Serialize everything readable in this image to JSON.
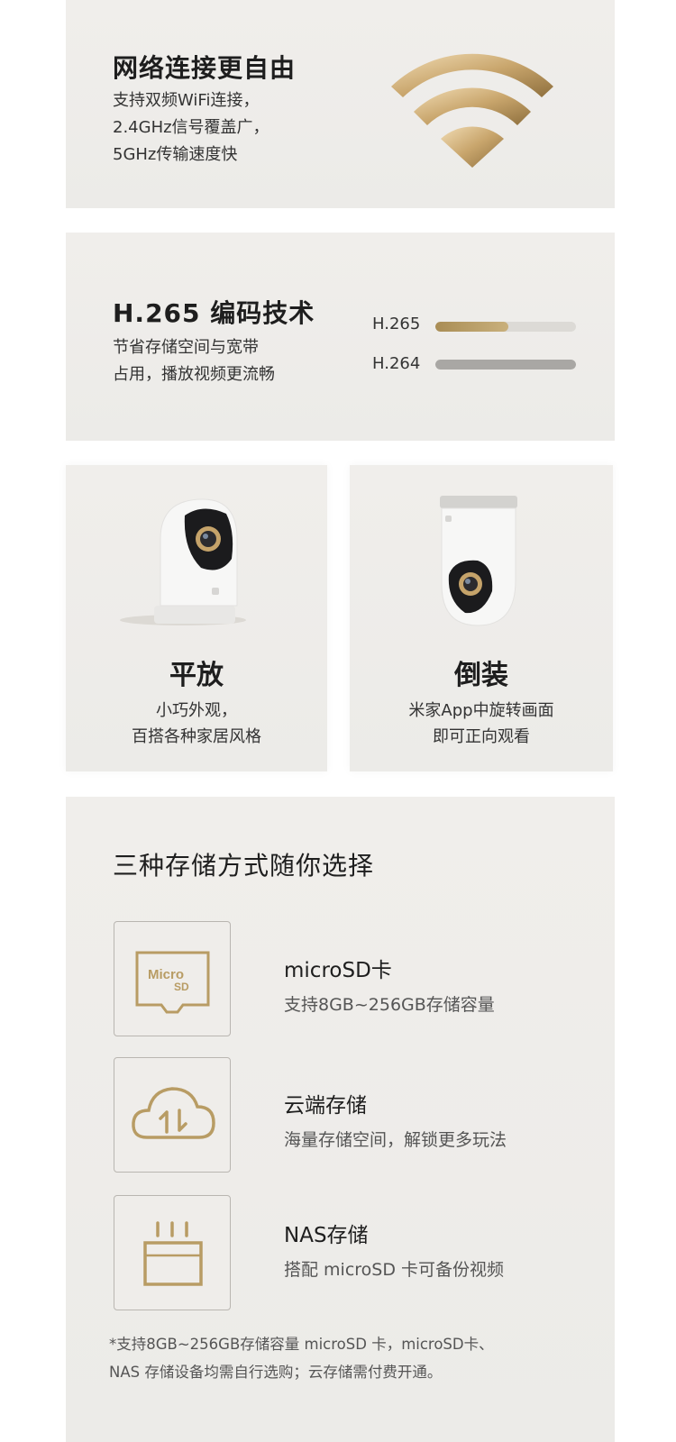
{
  "wifi": {
    "title": "网络连接更自由",
    "desc_lines": [
      "支持双频WiFi连接，",
      "2.4GHz信号覆盖广，",
      "5GHz传输速度快"
    ],
    "icon": "wifi-icon"
  },
  "codec": {
    "title": "H.265 编码技术",
    "desc_lines": [
      "节省存储空间与宽带",
      "占用，播放视频更流畅"
    ],
    "bars": [
      {
        "label": "H.265",
        "fill_fraction": 0.52,
        "color": "#b49a63"
      },
      {
        "label": "H.264",
        "fill_fraction": 1.0,
        "color": "#a9a7a4"
      }
    ]
  },
  "mounting": [
    {
      "title": "平放",
      "desc_lines": [
        "小巧外观，",
        "百搭各种家居风格"
      ]
    },
    {
      "title": "倒装",
      "desc_lines": [
        "米家App中旋转画面",
        "即可正向观看"
      ]
    }
  ],
  "storage": {
    "title": "三种存储方式随你选择",
    "options": [
      {
        "icon": "microsd-card-icon",
        "name": "microSD卡",
        "desc": "支持8GB~256GB存储容量",
        "icon_text": "Micro SD"
      },
      {
        "icon": "cloud-sync-icon",
        "name": "云端存储",
        "desc": "海量存储空间，解锁更多玩法"
      },
      {
        "icon": "nas-router-icon",
        "name": "NAS存储",
        "desc": "搭配 microSD 卡可备份视频"
      }
    ],
    "footnote_lines": [
      "*支持8GB~256GB存储容量 microSD 卡，microSD卡、",
      " NAS 存储设备均需自行选购；云存储需付费开通。"
    ]
  },
  "colors": {
    "gold": "#b49a63",
    "card_bg": "#eeece9"
  }
}
